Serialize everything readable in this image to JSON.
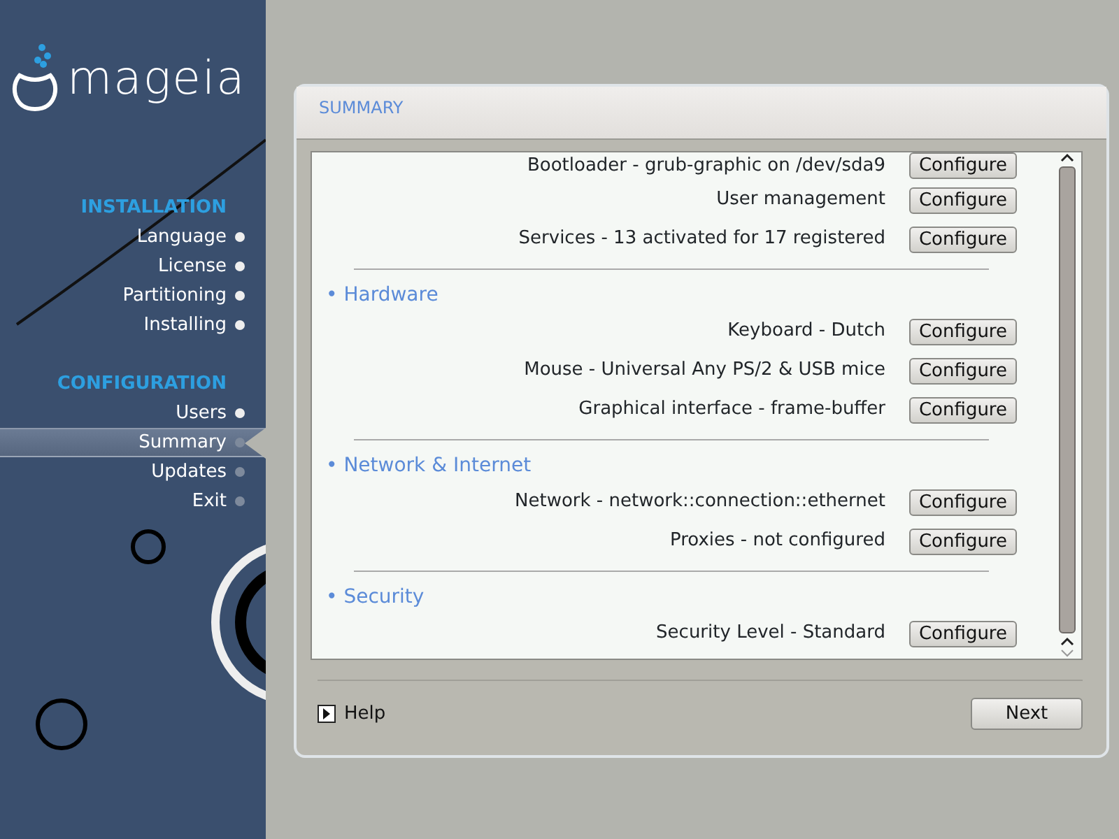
{
  "logo": {
    "text": "mageia"
  },
  "steps": [
    {
      "heading": "INSTALLATION",
      "items": [
        {
          "label": "Language",
          "done": true,
          "selected": false
        },
        {
          "label": "License",
          "done": true,
          "selected": false
        },
        {
          "label": "Partitioning",
          "done": true,
          "selected": false
        },
        {
          "label": "Installing",
          "done": true,
          "selected": false
        }
      ]
    },
    {
      "heading": "CONFIGURATION",
      "items": [
        {
          "label": "Users",
          "done": true,
          "selected": false
        },
        {
          "label": "Summary",
          "done": false,
          "selected": true
        },
        {
          "label": "Updates",
          "done": false,
          "selected": false
        },
        {
          "label": "Exit",
          "done": false,
          "selected": false
        }
      ]
    }
  ],
  "panel": {
    "title": "SUMMARY",
    "sections": [
      {
        "items": [
          {
            "label": "Bootloader - grub-graphic on /dev/sda9",
            "button": "Configure"
          },
          {
            "label": "User management",
            "button": "Configure"
          },
          {
            "label": "Services - 13 activated for 17 registered",
            "button": "Configure"
          }
        ]
      },
      {
        "heading": "• Hardware",
        "items": [
          {
            "label": "Keyboard - Dutch",
            "button": "Configure"
          },
          {
            "label": "Mouse - Universal Any PS/2 & USB mice",
            "button": "Configure"
          },
          {
            "label": "Graphical interface - frame-buffer",
            "button": "Configure"
          }
        ]
      },
      {
        "heading": "• Network & Internet",
        "items": [
          {
            "label": "Network - network::connection::ethernet",
            "button": "Configure"
          },
          {
            "label": "Proxies - not configured",
            "button": "Configure"
          }
        ]
      },
      {
        "heading": "• Security",
        "items": [
          {
            "label": "Security Level - Standard",
            "button": "Configure"
          }
        ]
      }
    ],
    "help": "Help",
    "next": "Next"
  }
}
